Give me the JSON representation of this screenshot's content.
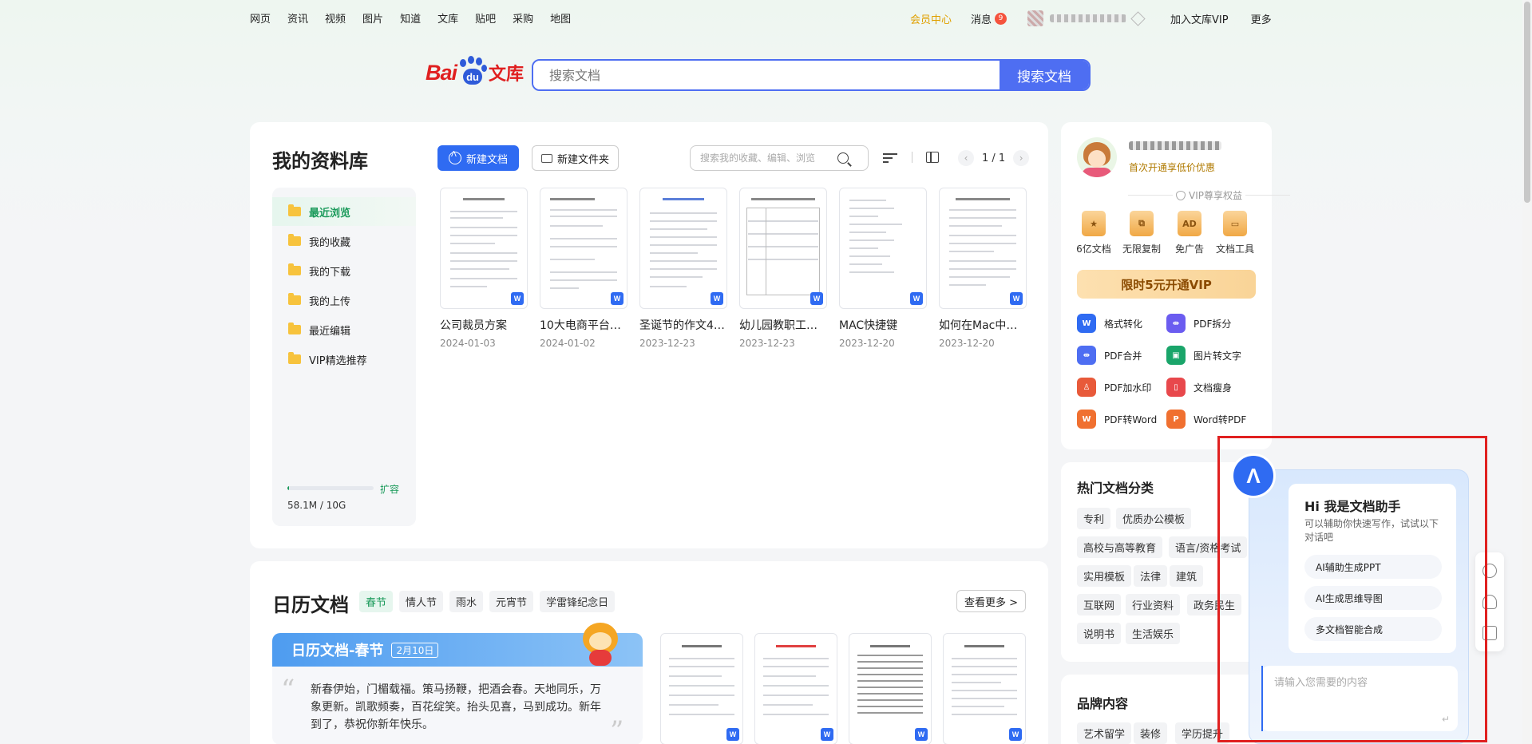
{
  "nav": {
    "links": [
      "网页",
      "资讯",
      "视频",
      "图片",
      "知道",
      "文库",
      "贴吧",
      "采购",
      "地图"
    ],
    "vip_center": "会员中心",
    "messages": "消息",
    "messages_count": "9",
    "join_vip": "加入文库VIP",
    "more": "更多"
  },
  "logo": {
    "bai": "Bai",
    "du": "du",
    "wenku": "文库"
  },
  "search": {
    "placeholder": "搜索文档",
    "button": "搜索文档"
  },
  "library": {
    "title": "我的资料库",
    "new_doc": "新建文档",
    "new_folder": "新建文件夹",
    "search_placeholder": "搜索我的收藏、编辑、浏览",
    "page": "1 / 1",
    "sidebar": [
      "最近浏览",
      "我的收藏",
      "我的下载",
      "我的上传",
      "最近编辑",
      "VIP精选推荐"
    ],
    "expand": "扩容",
    "storage_text": "58.1M / 10G",
    "storage_used_fraction": 0.006,
    "docs": [
      {
        "name": "公司裁员方案",
        "date": "2024-01-03"
      },
      {
        "name": "10大电商平台…",
        "date": "2024-01-02"
      },
      {
        "name": "圣诞节的作文4…",
        "date": "2023-12-23"
      },
      {
        "name": "幼儿园教职工…",
        "date": "2023-12-23"
      },
      {
        "name": "MAC快捷键",
        "date": "2023-12-20"
      },
      {
        "name": "如何在Mac中…",
        "date": "2023-12-20"
      }
    ]
  },
  "calendar": {
    "title": "日历文档",
    "tags": [
      "春节",
      "情人节",
      "雨水",
      "元宵节",
      "学雷锋纪念日"
    ],
    "see_more": "查看更多 >",
    "card_title": "日历文档-春节",
    "card_date": "2月10日",
    "card_text": "新春伊始，门楣载福。策马扬鞭，把酒会春。天地同乐，万象更新。凯歌频奏，百花绽笑。抬头见喜，马到成功。新年到了，恭祝你新年快乐。"
  },
  "account": {
    "promo": "首次开通享低价优惠",
    "vip_rights": "VIP尊享权益",
    "perks": [
      {
        "label": "6亿文档",
        "glyph": "★"
      },
      {
        "label": "无限复制",
        "glyph": "⧉"
      },
      {
        "label": "免广告",
        "glyph": "AD"
      },
      {
        "label": "文档工具",
        "glyph": "▭"
      }
    ],
    "vip_button": "限时5元开通VIP",
    "tools": [
      {
        "label": "格式转化",
        "glyph": "W",
        "color": "#2f6bf2"
      },
      {
        "label": "PDF拆分",
        "glyph": "⇹",
        "color": "#6b5cf0"
      },
      {
        "label": "PDF合并",
        "glyph": "⇹",
        "color": "#4e6ef2"
      },
      {
        "label": "图片转文字",
        "glyph": "▣",
        "color": "#1aa56a"
      },
      {
        "label": "PDF加水印",
        "glyph": "♙",
        "color": "#e85a3a"
      },
      {
        "label": "文档瘦身",
        "glyph": "▯",
        "color": "#e8484c"
      },
      {
        "label": "PDF转Word",
        "glyph": "W",
        "color": "#f07030"
      },
      {
        "label": "Word转PDF",
        "glyph": "P",
        "color": "#f07030"
      }
    ]
  },
  "hot": {
    "title": "热门文档分类",
    "tags": [
      "专利",
      "优质办公模板",
      "高校与高等教育",
      "语言/资格考试",
      "实用模板",
      "法律",
      "建筑",
      "互联网",
      "行业资料",
      "政务民生",
      "说明书",
      "生活娱乐"
    ]
  },
  "brand": {
    "title": "品牌内容",
    "tags": [
      "艺术留学",
      "装修",
      "学历提升"
    ]
  },
  "assistant": {
    "avatar": "Λ",
    "hi": "Hi 我是文档助手",
    "sub": "可以辅助你快速写作，试试以下对话吧",
    "options": [
      "AI辅助生成PPT",
      "AI生成思维导图",
      "多文档智能合成"
    ],
    "input_placeholder": "请输入您需要的内容",
    "enter": "↵"
  },
  "colors": {
    "accent": "#4e6ef2",
    "green": "#1a9a5a",
    "vip_gold": "#e0a000",
    "highlight_red": "#e02020"
  }
}
